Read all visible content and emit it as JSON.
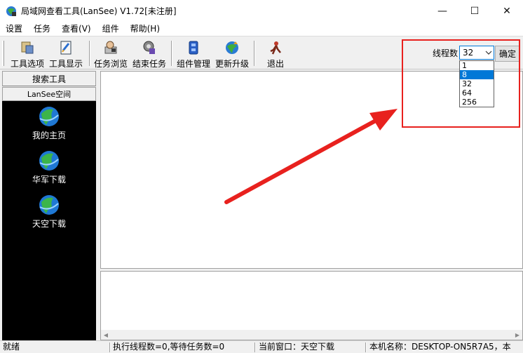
{
  "window": {
    "title": "局域网查看工具(LanSee) V1.72[未注册]",
    "minimize_glyph": "—",
    "maximize_glyph": "☐",
    "close_glyph": "✕"
  },
  "menu": [
    "设置",
    "任务",
    "查看(V)",
    "组件",
    "帮助(H)"
  ],
  "toolbar": {
    "buttons": [
      {
        "label": "工具选项",
        "icon": "tool-options-icon"
      },
      {
        "label": "工具显示",
        "icon": "tool-display-icon"
      },
      {
        "label": "任务浏览",
        "icon": "task-browse-icon"
      },
      {
        "label": "结束任务",
        "icon": "end-task-icon"
      },
      {
        "label": "组件管理",
        "icon": "component-manage-icon"
      },
      {
        "label": "更新升级",
        "icon": "update-icon"
      },
      {
        "label": "退出",
        "icon": "exit-icon"
      }
    ],
    "thread_label": "线程数",
    "thread_value": "32",
    "thread_options": [
      "1",
      "8",
      "32",
      "64",
      "256"
    ],
    "thread_highlighted": "8",
    "confirm_label": "确定"
  },
  "left_panel": {
    "search_tab": "搜索工具",
    "lansee_tab": "LanSee空间",
    "items": [
      {
        "label": "我的主页",
        "icon": "globe-icon"
      },
      {
        "label": "华军下载",
        "icon": "globe-icon"
      },
      {
        "label": "天空下载",
        "icon": "globe-icon"
      }
    ]
  },
  "status": {
    "ready": "就绪",
    "threads": "执行线程数=0,等待任务数=0",
    "current_window": "当前窗口：天空下载",
    "machine": "本机名称：DESKTOP-ON5R7A5，本"
  },
  "colors": {
    "annotation_red": "#e8211e",
    "selection_blue": "#0078d7"
  }
}
